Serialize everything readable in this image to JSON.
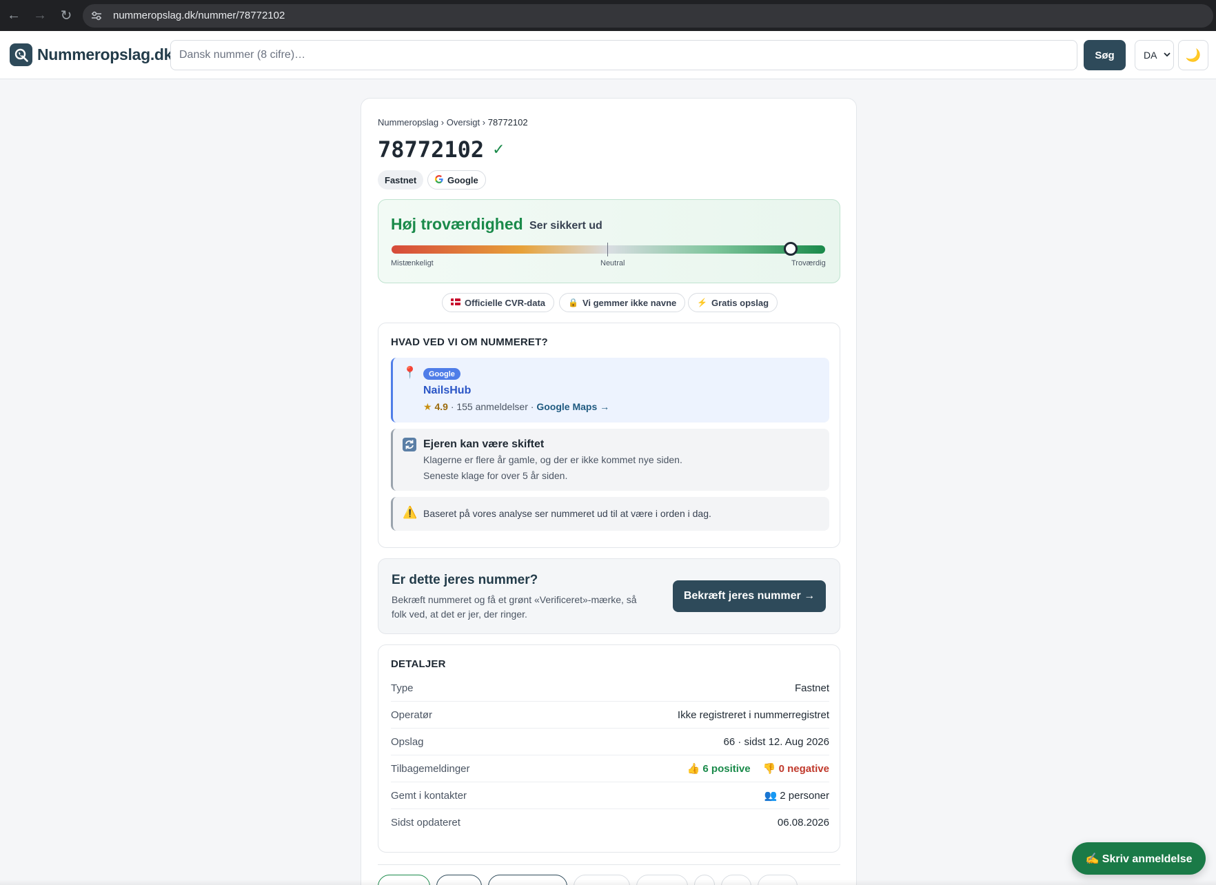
{
  "browser": {
    "url": "nummeropslag.dk/nummer/78772102"
  },
  "header": {
    "logo_text": "Nummeropslag.dk",
    "search_placeholder": "Dansk nummer (8 cifre)…",
    "search_button": "Søg",
    "language": "DA",
    "theme_icon": "moon-icon"
  },
  "breadcrumb": {
    "items": [
      "Nummeropslag",
      "Oversigt",
      "78772102"
    ],
    "separator": "›"
  },
  "number": {
    "title": "78772102",
    "verified_mark": "✓",
    "chips": [
      "Fastnet",
      "Google"
    ]
  },
  "trust": {
    "title": "Høj troværdighed",
    "subtitle": "Ser sikkert ud",
    "score_fraction": 0.92,
    "labels": [
      "Mistænkeligt",
      "Neutral",
      "Troværdig"
    ]
  },
  "badges": [
    {
      "icon": "flag-dk-icon",
      "label": "Officielle CVR-data"
    },
    {
      "icon": "lock-icon",
      "label": "Vi gemmer ikke navne"
    },
    {
      "icon": "lightning-icon",
      "label": "Gratis opslag"
    }
  ],
  "info": {
    "title": "HVAD VED VI OM NUMMERET?",
    "google": {
      "tag": "Google",
      "name": "NailsHub",
      "star": "★",
      "rating": "4.9",
      "reviews": "· 155 anmeldelser ·",
      "maps_link": "Google Maps →"
    },
    "owner": {
      "title": "Ejeren kan være skiftet",
      "line1": "Klagerne er flere år gamle, og der er ikke kommet nye siden.",
      "line2": "Seneste klage for over 5 år siden."
    },
    "warning": {
      "text": "Baseret på vores analyse ser nummeret ud til at være i orden i dag."
    }
  },
  "claim": {
    "title": "Er dette jeres nummer?",
    "text": "Bekræft nummeret og få et grønt «Verificeret»-mærke, så folk ved, at det er jer, der ringer.",
    "button": "Bekræft jeres nummer →"
  },
  "details": {
    "title": "DETALJER",
    "rows": [
      {
        "key": "Type",
        "value": "Fastnet"
      },
      {
        "key": "Operatør",
        "value": "Ikke registreret i nummerregistret"
      },
      {
        "key": "Opslag",
        "value": "66 · sidst 12. Aug 2026"
      },
      {
        "key": "Tilbagemeldinger",
        "positive": "👍 6 positive",
        "negative": "👎 0 negative"
      },
      {
        "key": "Gemt i kontakter",
        "value": "👥 2 personer"
      },
      {
        "key": "Sidst opdateret",
        "value": "06.08.2026"
      }
    ]
  },
  "review_button": "✍️ Skriv anmeldelse",
  "colors": {
    "brand": "#2e4a5a",
    "trust_green": "#1a8a4a",
    "google_blue": "#4f7de8",
    "negative_red": "#c0392b"
  }
}
